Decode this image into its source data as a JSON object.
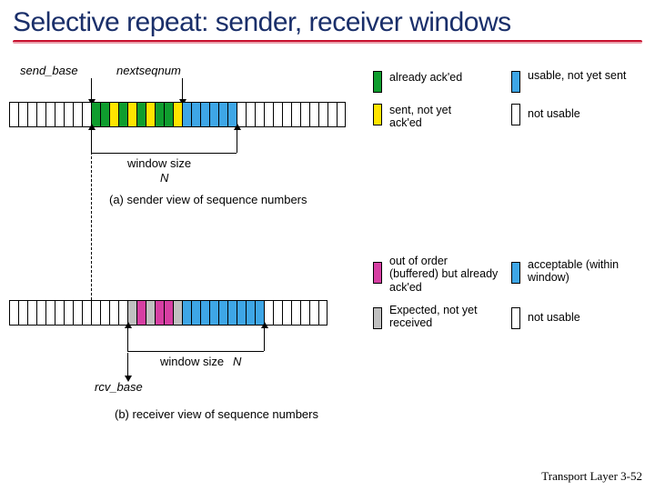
{
  "title": "Selective repeat: sender, receiver windows",
  "sender": {
    "send_base_label": "send_base",
    "nextseqnum_label": "nextseqnum",
    "window_label": "window size",
    "n_label": "N",
    "caption": "(a) sender view of sequence numbers",
    "legend": {
      "acked": "already ack'ed",
      "sent_unacked": "sent, not yet ack'ed",
      "usable": "usable, not yet sent",
      "not_usable": "not usable"
    }
  },
  "receiver": {
    "rcv_base_label": "rcv_base",
    "window_label": "window size",
    "n_label": "N",
    "caption": "(b) receiver view of sequence numbers",
    "legend": {
      "buffered": "out of order (buffered) but already ack'ed",
      "expected": "Expected,  not yet received",
      "acceptable": "acceptable (within window)",
      "not_usable": "not usable"
    }
  },
  "footer": {
    "chapter": "Transport Layer",
    "page": "3-52"
  },
  "colors": {
    "green": "#0f9d2e",
    "yellow": "#ffe400",
    "blue": "#3ea6e6",
    "magenta": "#d63fa3",
    "gray": "#c0c0c0"
  },
  "chart_data": {
    "type": "table",
    "description": "Two horizontal sequence-number strips of equal length N_total cells with a window of width N. Colors encode cell state.",
    "sender_states": [
      "white",
      "white",
      "white",
      "white",
      "white",
      "white",
      "white",
      "white",
      "white",
      "green",
      "green",
      "yellow",
      "green",
      "yellow",
      "green",
      "yellow",
      "green",
      "green",
      "yellow",
      "blue",
      "blue",
      "blue",
      "blue",
      "blue",
      "blue",
      "white",
      "white",
      "white",
      "white",
      "white",
      "white",
      "white",
      "white",
      "white",
      "white",
      "white",
      "white"
    ],
    "receiver_states": [
      "white",
      "white",
      "white",
      "white",
      "white",
      "white",
      "white",
      "white",
      "white",
      "white",
      "white",
      "white",
      "white",
      "gray",
      "magenta",
      "gray",
      "magenta",
      "magenta",
      "gray",
      "blue",
      "blue",
      "blue",
      "blue",
      "blue",
      "blue",
      "blue",
      "blue",
      "blue",
      "white",
      "white",
      "white",
      "white",
      "white",
      "white",
      "white"
    ],
    "window_N": 16
  }
}
